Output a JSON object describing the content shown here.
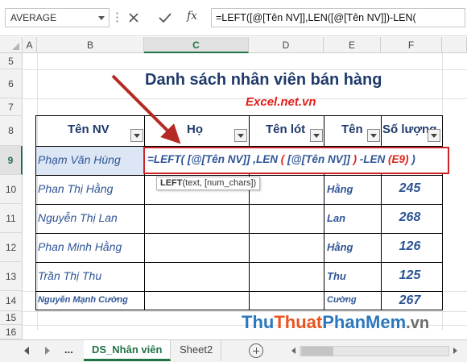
{
  "formula_bar": {
    "name_box": "AVERAGE",
    "formula": "=LEFT([@[Tên NV]],LEN([@[Tên NV]])-LEN(",
    "fx_label": "fx"
  },
  "columns": [
    "A",
    "B",
    "C",
    "D",
    "E",
    "F"
  ],
  "active_column": "C",
  "rows": [
    "5",
    "6",
    "7",
    "8",
    "9",
    "10",
    "11",
    "12",
    "13",
    "14",
    "15",
    "16"
  ],
  "active_row": "9",
  "title": "Danh sách nhân viên bán hàng",
  "brand": "Excel.net.vn",
  "table": {
    "headers": [
      "Tên NV",
      "Họ",
      "Tên lót",
      "Tên",
      "Số lượng"
    ],
    "names": [
      "Phạm Văn Hùng",
      "Phan Thị Hằng",
      "Nguyễn Thị Lan",
      "Phan Minh Hằng",
      "Trần Thị Thu",
      "Nguyễn Mạnh Cường"
    ],
    "ten": [
      "Hằng",
      "Lan",
      "Hằng",
      "Thu",
      "Cường"
    ],
    "quantities": [
      "245",
      "268",
      "126",
      "125",
      "267"
    ]
  },
  "cell_edit": {
    "p1": "=LEFT(",
    "p2": " [@[Tên NV]] ",
    "p3": ",LEN",
    "p4": " ( ",
    "p5": "[@[Tên NV]]",
    "p6": " ) ",
    "p7": "-LEN",
    "p8": " (E9)",
    "p9": " )"
  },
  "tooltip": {
    "fn": "LEFT",
    "args": "(text, [num_chars])"
  },
  "sheets": {
    "dots": "...",
    "tabs": [
      "DS_Nhân viên",
      "Sheet2"
    ],
    "active": "DS_Nhân viên"
  },
  "watermark": {
    "w1": "Thu",
    "w2": "Thuat",
    "w3": "PhanMem",
    "domain": ".vn"
  },
  "colors": {
    "accent": "#217346",
    "header_text": "#1f3a6b",
    "cell_text": "#2e5596",
    "brand_red": "#e0201b",
    "edit_border": "#cc2424"
  }
}
